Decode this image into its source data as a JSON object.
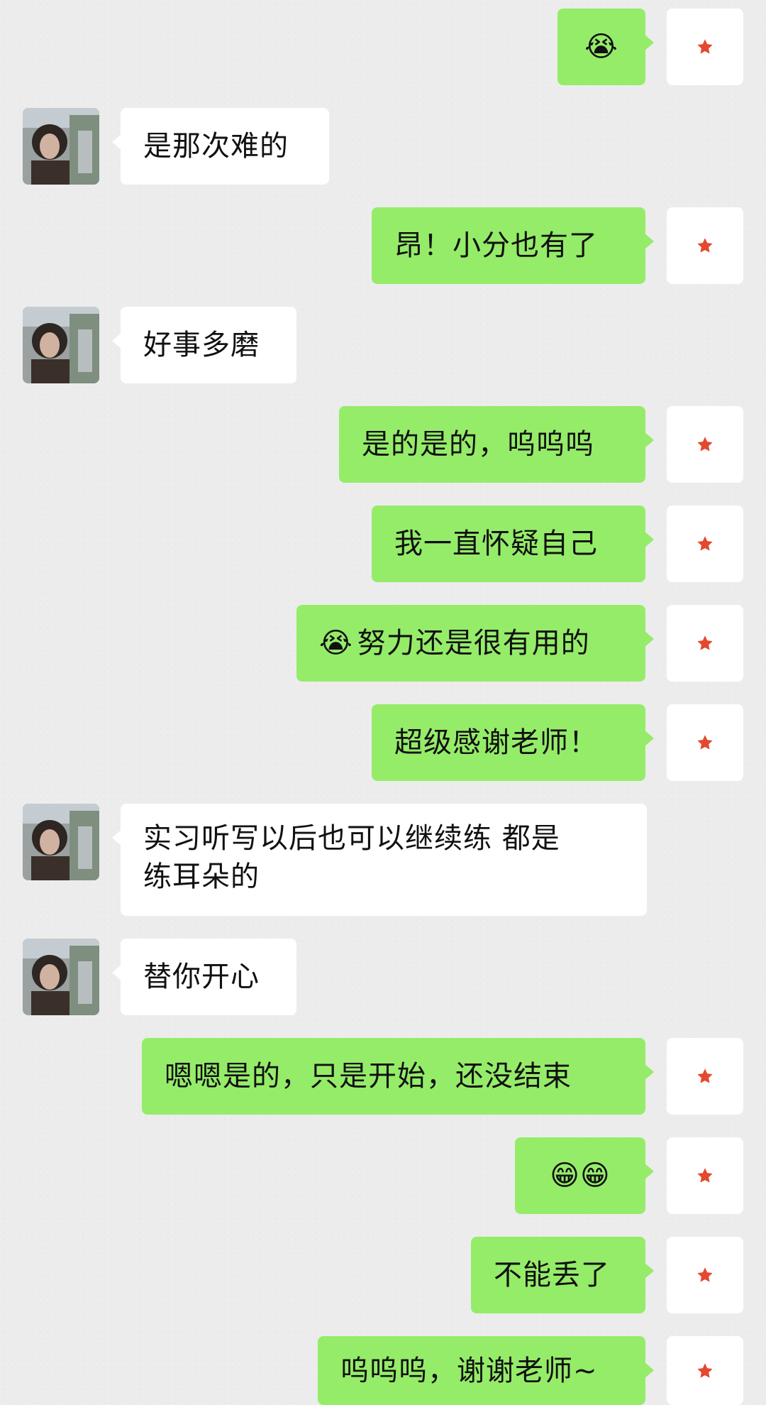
{
  "messages": [
    {
      "side": "right",
      "kind": "emoji",
      "text": "😭"
    },
    {
      "side": "left",
      "text": "是那次难的"
    },
    {
      "side": "right",
      "text": "昂！小分也有了"
    },
    {
      "side": "left",
      "text": "好事多磨"
    },
    {
      "side": "right",
      "text": "是的是的，呜呜呜"
    },
    {
      "side": "right",
      "text": "我一直怀疑自己"
    },
    {
      "side": "right",
      "prefix_emoji": "😭",
      "text": "努力还是很有用的"
    },
    {
      "side": "right",
      "text": "超级感谢老师！"
    },
    {
      "side": "left",
      "text": "实习听写以后也可以继续练 都是\n练耳朵的"
    },
    {
      "side": "left",
      "text": "替你开心"
    },
    {
      "side": "right",
      "text": "嗯嗯是的，只是开始，还没结束"
    },
    {
      "side": "right",
      "kind": "emoji",
      "text": "😁😁"
    },
    {
      "side": "right",
      "text": "不能丢了"
    },
    {
      "side": "right",
      "text": "呜呜呜，谢谢老师~"
    }
  ],
  "avatars": {
    "left": "avatar-photo-woman",
    "right": "red-star-icon"
  },
  "colors": {
    "background": "#ececec",
    "green_bubble": "#95ec69",
    "white_bubble": "#ffffff",
    "text": "#111111",
    "star": "#e2492f"
  }
}
